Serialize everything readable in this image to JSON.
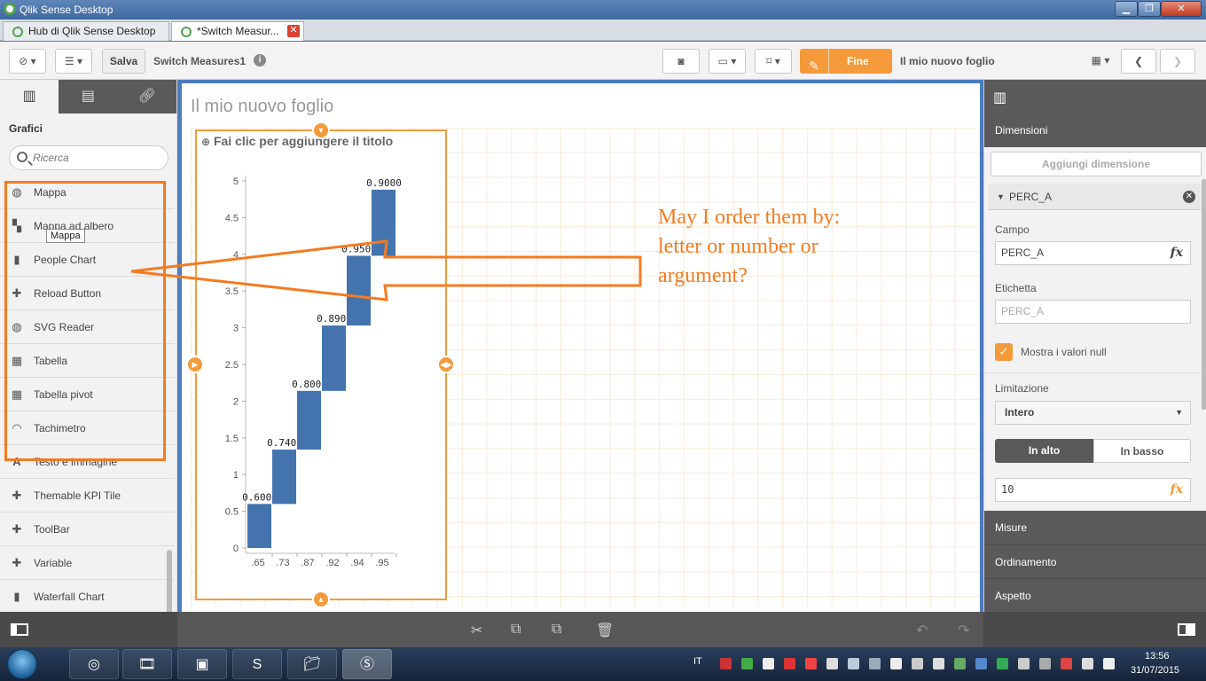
{
  "window": {
    "title": "Qlik Sense Desktop"
  },
  "tabs": [
    {
      "label": "Hub di Qlik Sense Desktop"
    },
    {
      "label": "*Switch Measur..."
    }
  ],
  "toolbar": {
    "save_label": "Salva",
    "app_name": "Switch Measures1",
    "done_label": "Fine",
    "sheet_name": "Il mio nuovo foglio"
  },
  "left_panel": {
    "section_title": "Grafici",
    "search_placeholder": "Ricerca",
    "tooltip": "Mappa",
    "items": [
      {
        "label": "Mappa",
        "icon": "globe-icon"
      },
      {
        "label": "Mappa ad albero",
        "icon": "treemap-icon"
      },
      {
        "label": "People Chart",
        "icon": "bar-chart-icon"
      },
      {
        "label": "Reload Button",
        "icon": "puzzle-icon"
      },
      {
        "label": "SVG Reader",
        "icon": "globe-icon"
      },
      {
        "label": "Tabella",
        "icon": "table-icon"
      },
      {
        "label": "Tabella pivot",
        "icon": "pivot-table-icon"
      },
      {
        "label": "Tachimetro",
        "icon": "gauge-icon"
      },
      {
        "label": "Testo e immagine",
        "icon": "text-icon"
      },
      {
        "label": "Themable KPI Tile",
        "icon": "puzzle-icon"
      },
      {
        "label": "ToolBar",
        "icon": "puzzle-icon"
      },
      {
        "label": "Variable",
        "icon": "puzzle-icon"
      },
      {
        "label": "Waterfall Chart",
        "icon": "bar-chart-icon"
      }
    ]
  },
  "canvas": {
    "sheet_title": "Il mio nuovo foglio",
    "chart_title_placeholder": "Fai clic per aggiungere il titolo"
  },
  "chart_data": {
    "type": "bar",
    "subtype": "waterfall",
    "categories": [
      ".65",
      ".73",
      ".87",
      ".92",
      ".94",
      ".95"
    ],
    "bar_start": [
      0,
      0.6,
      1.34,
      2.14,
      3.03,
      3.98
    ],
    "values": [
      0.6,
      0.74,
      0.8,
      0.89,
      0.95,
      0.9
    ],
    "data_labels": [
      "0.6000",
      "0.7400",
      "0.8000",
      "0.8900",
      "0.9500",
      "0.9000"
    ],
    "y_ticks": [
      "0",
      "0.5",
      "1",
      "1.5",
      "2",
      "2.5",
      "3",
      "3.5",
      "4",
      "4.5",
      "5"
    ],
    "ylim": [
      0,
      5
    ],
    "bar_color": "#4374ae",
    "grid": false
  },
  "right_panel": {
    "dimensions_header": "Dimensioni",
    "add_dimension": "Aggiungi dimensione",
    "dimension_name": "PERC_A",
    "field_label": "Campo",
    "field_value": "PERC_A",
    "label_label": "Etichetta",
    "label_placeholder": "PERC_A",
    "show_null_label": "Mostra i valori null",
    "limitation_label": "Limitazione",
    "limitation_value": "Intero",
    "top_label": "In alto",
    "bottom_label": "In basso",
    "limit_value": "10",
    "measures_header": "Misure",
    "sorting_header": "Ordinamento",
    "appearance_header": "Aspetto",
    "fx": "fx"
  },
  "annotation": {
    "lines": [
      "May I order them by:",
      "letter or number or",
      "argument?"
    ],
    "color": "#f47b20"
  },
  "taskbar": {
    "language": "IT",
    "time": "13:56",
    "date": "31/07/2015"
  }
}
